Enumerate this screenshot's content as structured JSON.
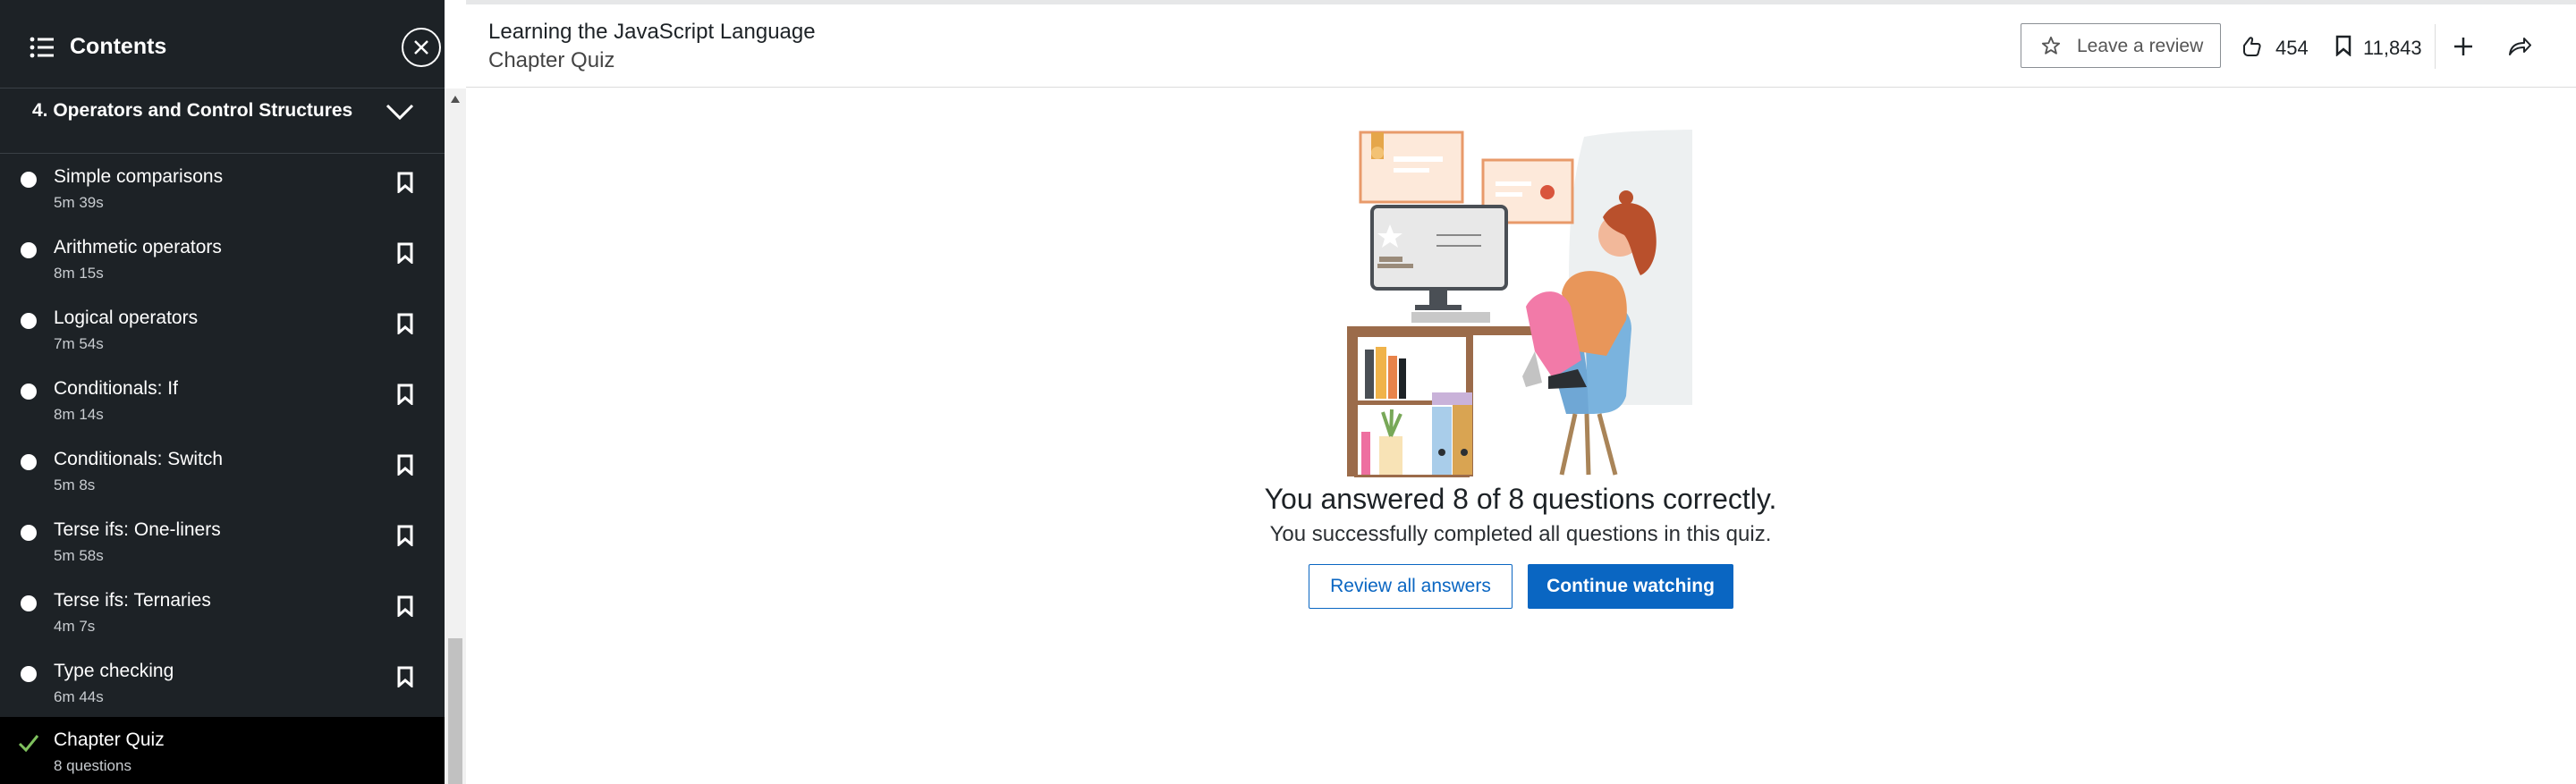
{
  "sidebar": {
    "title": "Contents",
    "section_label": "4. Operators and Control Structures",
    "items": [
      {
        "title": "Simple comparisons",
        "duration": "5m 39s"
      },
      {
        "title": "Arithmetic operators",
        "duration": "8m 15s"
      },
      {
        "title": "Logical operators",
        "duration": "7m 54s"
      },
      {
        "title": "Conditionals: If",
        "duration": "8m 14s"
      },
      {
        "title": "Conditionals: Switch",
        "duration": "5m 8s"
      },
      {
        "title": "Terse ifs: One-liners",
        "duration": "5m 58s"
      },
      {
        "title": "Terse ifs: Ternaries",
        "duration": "4m 7s"
      },
      {
        "title": "Type checking",
        "duration": "6m 44s"
      }
    ],
    "active_item": {
      "title": "Chapter Quiz",
      "duration": "8 questions"
    }
  },
  "header": {
    "title": "Learning the JavaScript Language",
    "subtitle": "Chapter Quiz",
    "review_label": "Leave a review",
    "likes": "454",
    "saves": "11,843"
  },
  "result": {
    "title": "You answered 8 of 8 questions correctly.",
    "subtitle": "You successfully completed all questions in this quiz.",
    "review_button": "Review all answers",
    "continue_button": "Continue watching"
  },
  "colors": {
    "sidebar_bg": "#1d2226",
    "accent": "#0a66c2",
    "check": "#7fc15e"
  }
}
